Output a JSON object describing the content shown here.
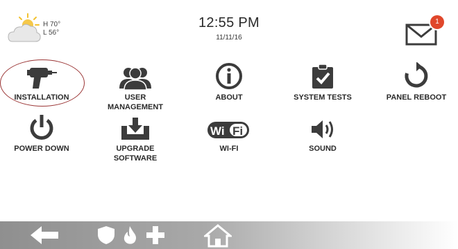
{
  "header": {
    "weather": {
      "icon": "partly-cloudy-icon",
      "high": "H 70°",
      "low": "L 56°"
    },
    "time": "12:55 PM",
    "date": "11/11/16",
    "messages": {
      "icon": "envelope-icon",
      "badge_count": "1",
      "badge_color": "#e0472b"
    }
  },
  "menu": [
    {
      "label": "INSTALLATION",
      "icon": "drill-icon"
    },
    {
      "label": "USER\nMANAGEMENT",
      "icon": "users-icon"
    },
    {
      "label": "ABOUT",
      "icon": "info-icon"
    },
    {
      "label": "SYSTEM TESTS",
      "icon": "clipboard-check-icon"
    },
    {
      "label": "PANEL REBOOT",
      "icon": "reboot-icon"
    },
    {
      "label": "POWER DOWN",
      "icon": "power-icon"
    },
    {
      "label": "UPGRADE\nSOFTWARE",
      "icon": "download-tray-icon"
    },
    {
      "label": "WI-FI",
      "icon": "wifi-logo-icon",
      "logo_text": "WiFi"
    },
    {
      "label": "SOUND",
      "icon": "speaker-icon"
    }
  ],
  "bottom_bar": {
    "icons": [
      "back-arrow-icon",
      "shield-icon",
      "fire-icon",
      "medical-plus-icon",
      "home-icon"
    ]
  },
  "colors": {
    "icon": "#3c3c3c",
    "highlight_ring": "#9a3434"
  }
}
